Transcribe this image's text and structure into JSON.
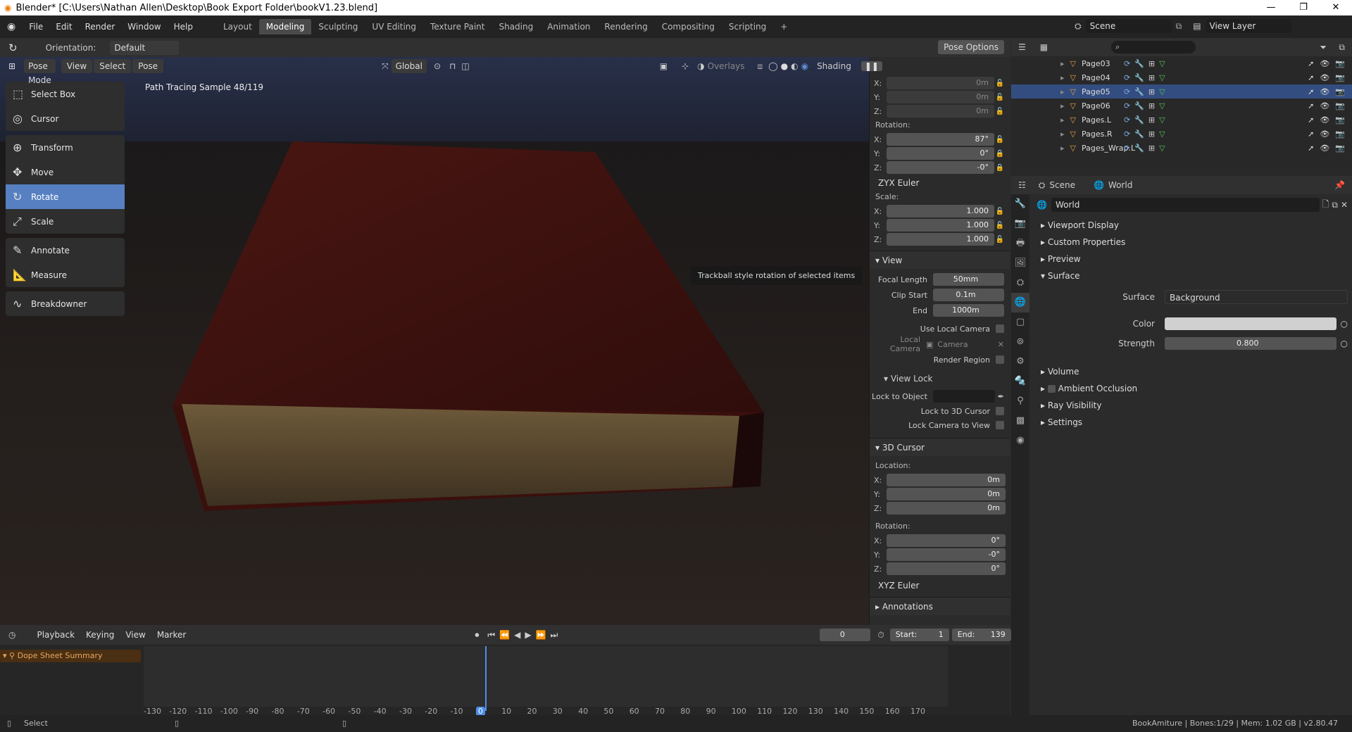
{
  "window": {
    "title": "Blender* [C:\\Users\\Nathan Allen\\Desktop\\Book Export Folder\\bookV1.23.blend]",
    "controls": [
      "—",
      "❐",
      "✕"
    ]
  },
  "menus": [
    "File",
    "Edit",
    "Render",
    "Window",
    "Help"
  ],
  "workspace_tabs": [
    "Layout",
    "Modeling",
    "Sculpting",
    "UV Editing",
    "Texture Paint",
    "Shading",
    "Animation",
    "Rendering",
    "Compositing",
    "Scripting"
  ],
  "active_tab": "Modeling",
  "scene": {
    "name": "Scene",
    "view_layer": "View Layer"
  },
  "tool_header": {
    "orientation_label": "Orientation:",
    "orientation_value": "Default",
    "pose_options": "Pose Options"
  },
  "viewport_header": {
    "mode": "Pose Mode",
    "menus": [
      "View",
      "Select",
      "Pose"
    ],
    "transform": "Global",
    "overlays": "Overlays",
    "shading": "Shading"
  },
  "viewport": {
    "status": "Path Tracing Sample 48/119",
    "tooltip": "Trackball style rotation of selected items"
  },
  "toolbar": [
    [
      {
        "label": "Select Box",
        "icon": "select-box-icon",
        "glyph": "⬚"
      },
      {
        "label": "Cursor",
        "icon": "cursor-icon",
        "glyph": "◎"
      }
    ],
    [
      {
        "label": "Transform",
        "icon": "transform-icon",
        "glyph": "⊕"
      },
      {
        "label": "Move",
        "icon": "move-icon",
        "glyph": "✥"
      },
      {
        "label": "Rotate",
        "icon": "rotate-icon",
        "glyph": "↻"
      },
      {
        "label": "Scale",
        "icon": "scale-icon",
        "glyph": "⤢"
      }
    ],
    [
      {
        "label": "Annotate",
        "icon": "annotate-icon",
        "glyph": "✎"
      },
      {
        "label": "Measure",
        "icon": "measure-icon",
        "glyph": "📐"
      }
    ],
    [
      {
        "label": "Breakdowner",
        "icon": "breakdowner-icon",
        "glyph": "∿"
      }
    ]
  ],
  "active_tool": "Rotate",
  "npanel": {
    "location": {
      "x": "0m",
      "y": "0m",
      "z": "0m"
    },
    "rotation_label": "Rotation:",
    "rotation": {
      "x": "87°",
      "y": "0°",
      "z": "-0°"
    },
    "rotation_mode": "ZYX Euler",
    "scale_label": "Scale:",
    "scale": {
      "x": "1.000",
      "y": "1.000",
      "z": "1.000"
    },
    "view": {
      "title": "View",
      "focal_length_label": "Focal Length",
      "focal_length": "50mm",
      "clip_start_label": "Clip Start",
      "clip_start": "0.1m",
      "end_label": "End",
      "end": "1000m",
      "use_local_camera": "Use Local Camera",
      "local_camera_label": "Local Camera",
      "local_camera": "Camera",
      "render_region": "Render Region"
    },
    "view_lock": {
      "title": "View Lock",
      "lock_to_object": "Lock to Object",
      "lock_to_cursor": "Lock to 3D Cursor",
      "lock_camera": "Lock Camera to View"
    },
    "cursor": {
      "title": "3D Cursor",
      "location_label": "Location:",
      "location": {
        "x": "0m",
        "y": "0m",
        "z": "0m"
      },
      "rotation_label": "Rotation:",
      "rotation": {
        "x": "0°",
        "y": "-0°",
        "z": "0°"
      },
      "rotation_mode": "XYZ Euler"
    },
    "annotations": "Annotations",
    "axis": {
      "x": "X:",
      "y": "Y:",
      "z": "Z:"
    }
  },
  "outliner": {
    "items": [
      {
        "name": "Page03",
        "selected": false
      },
      {
        "name": "Page04",
        "selected": false
      },
      {
        "name": "Page05",
        "selected": true
      },
      {
        "name": "Page06",
        "selected": false
      },
      {
        "name": "Pages.L",
        "selected": false
      },
      {
        "name": "Pages.R",
        "selected": false
      },
      {
        "name": "Pages_Wrap.L",
        "selected": false
      }
    ]
  },
  "properties": {
    "breadcrumb": {
      "scene": "Scene",
      "world": "World"
    },
    "world_name": "World",
    "sections": [
      "Viewport Display",
      "Custom Properties",
      "Preview",
      "Surface"
    ],
    "surface": {
      "surface_label": "Surface",
      "surface_value": "Background",
      "color_label": "Color",
      "color": "#d0d0d0",
      "strength_label": "Strength",
      "strength": "0.800"
    },
    "more_sections": [
      "Volume",
      "Ambient Occlusion",
      "Ray Visibility",
      "Settings"
    ]
  },
  "timeline": {
    "menus": [
      "Playback",
      "Keying",
      "View",
      "Marker"
    ],
    "current_frame": "0",
    "start_label": "Start:",
    "start": "1",
    "end_label": "End:",
    "end": "139",
    "summary": "Dope Sheet Summary",
    "ticks": [
      "-130",
      "-120",
      "-110",
      "-100",
      "-90",
      "-80",
      "-70",
      "-60",
      "-50",
      "-40",
      "-30",
      "-20",
      "-10",
      "0",
      "10",
      "20",
      "30",
      "40",
      "50",
      "60",
      "70",
      "80",
      "90",
      "100",
      "110",
      "120",
      "130",
      "140",
      "150",
      "160",
      "170"
    ]
  },
  "status": {
    "left": "Select",
    "right": "BookAmiture | Bones:1/29 | Mem: 1.02 GB | v2.80.47"
  }
}
